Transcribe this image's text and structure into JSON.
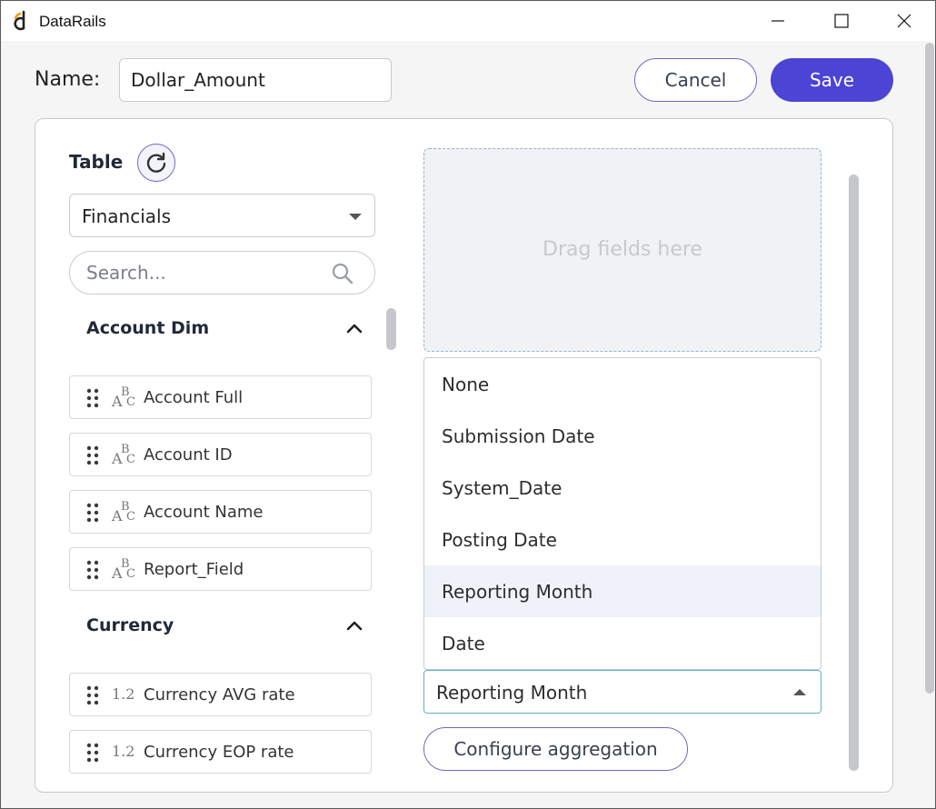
{
  "window": {
    "title": "DataRails",
    "icon": "datarails-logo",
    "controls": [
      "minimize-icon",
      "maximize-icon",
      "close-icon"
    ]
  },
  "header": {
    "name_label": "Name:",
    "name_value": "Dollar_Amount",
    "cancel_label": "Cancel",
    "save_label": "Save",
    "accent_color": "#4b44d4"
  },
  "sidebar": {
    "table_label": "Table",
    "table_value": "Financials",
    "search_placeholder": "Search...",
    "groups": [
      {
        "title": "Account Dim",
        "fields": [
          {
            "label": "Account Full",
            "type": "text"
          },
          {
            "label": "Account ID",
            "type": "text"
          },
          {
            "label": "Account Name",
            "type": "text"
          },
          {
            "label": "Report_Field",
            "type": "text"
          }
        ]
      },
      {
        "title": "Currency",
        "fields": [
          {
            "label": "Currency AVG rate",
            "type": "number"
          },
          {
            "label": "Currency EOP rate",
            "type": "number"
          }
        ]
      }
    ],
    "type_icons": {
      "text": "ABC",
      "number": "1.2"
    }
  },
  "main": {
    "drop_zone_text": "Drag fields here",
    "date_options": [
      "None",
      "Submission Date",
      "System_Date",
      "Posting Date",
      "Reporting Month",
      "Date"
    ],
    "selected_date": "Reporting Month",
    "configure_label": "Configure aggregation"
  }
}
